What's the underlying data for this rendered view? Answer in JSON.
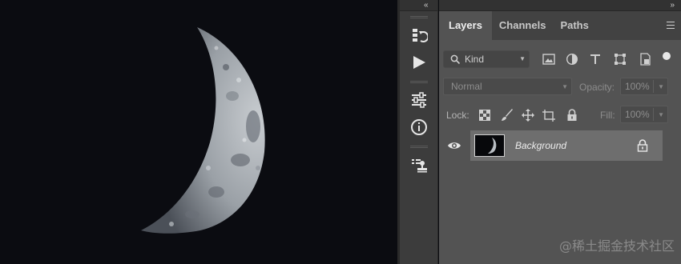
{
  "panel": {
    "tabs": [
      {
        "label": "Layers"
      },
      {
        "label": "Channels"
      },
      {
        "label": "Paths"
      }
    ],
    "filter": {
      "label": "Kind"
    },
    "blend": {
      "mode": "Normal",
      "opacity_label": "Opacity:",
      "opacity_value": "100%"
    },
    "lock": {
      "label": "Lock:",
      "fill_label": "Fill:",
      "fill_value": "100%"
    },
    "layer": {
      "name": "Background",
      "visible": true,
      "locked": true
    }
  },
  "icons": {
    "strip": [
      "history-icon",
      "play-icon",
      "adjustments-icon",
      "info-icon",
      "stamp-icon"
    ],
    "filter": [
      "image-filter-icon",
      "adjustment-filter-icon",
      "type-filter-icon",
      "shape-filter-icon",
      "smart-object-filter-icon",
      "filter-toggle-icon"
    ],
    "lock": [
      "lock-transparent-icon",
      "lock-image-icon",
      "lock-position-icon",
      "lock-artboard-icon",
      "lock-all-icon"
    ]
  },
  "watermark": "@稀土掘金技术社区"
}
